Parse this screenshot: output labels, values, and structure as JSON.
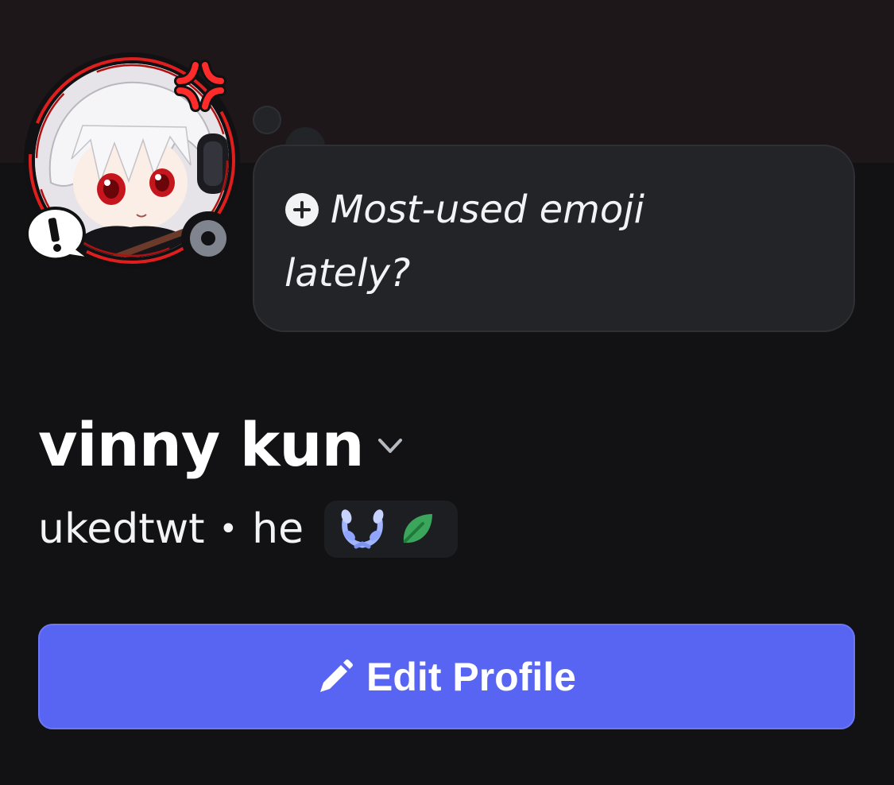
{
  "profile": {
    "display_name": "vinny kun",
    "username": "ukedtwt",
    "separator": "•",
    "pronouns": "he",
    "status": "offline"
  },
  "custom_status": {
    "prompt": "Most-used emoji lately?",
    "icon": "plus-circle-icon"
  },
  "badges": [
    {
      "name": "laurel-badge-icon",
      "color": "#a0b4ff"
    },
    {
      "name": "leaf-badge-icon",
      "color": "#3ba55c"
    }
  ],
  "actions": {
    "edit_profile_label": "Edit Profile",
    "edit_icon": "pencil-icon"
  },
  "colors": {
    "banner": "#1e1719",
    "background": "#121214",
    "accent": "#5865f2",
    "avatar_deco": "#e01e1e"
  }
}
